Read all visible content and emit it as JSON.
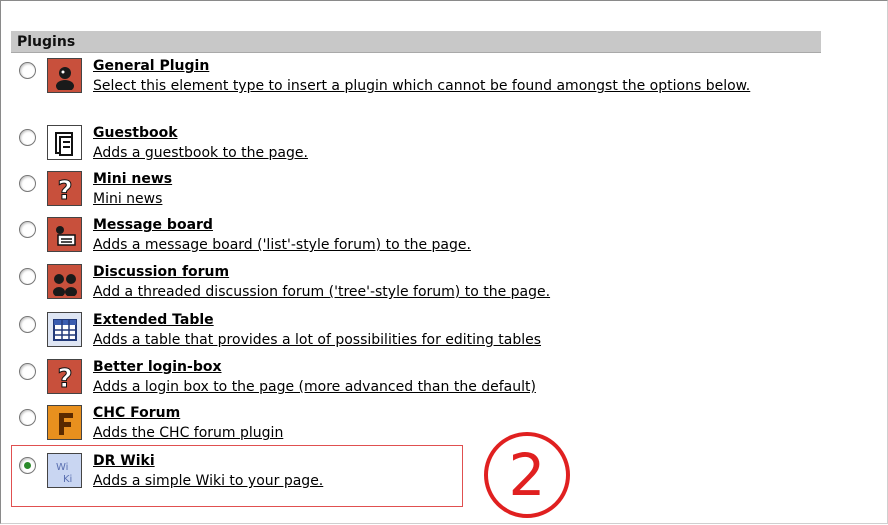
{
  "section": {
    "title": "Plugins"
  },
  "plugins": [
    {
      "title": "General Plugin",
      "description": "Select this element type to insert a plugin which cannot be found amongst the options below.",
      "icon": "general-plugin-icon",
      "selected": false
    },
    {
      "title": "Guestbook",
      "description": "Adds a guestbook to the page.",
      "icon": "guestbook-icon",
      "selected": false
    },
    {
      "title": "Mini news",
      "description": "Mini news",
      "icon": "mini-news-icon",
      "selected": false
    },
    {
      "title": "Message board",
      "description": "Adds a message board ('list'-style forum) to the page.",
      "icon": "message-board-icon",
      "selected": false
    },
    {
      "title": "Discussion forum",
      "description": "Add a threaded discussion forum ('tree'-style forum) to the page.",
      "icon": "discussion-forum-icon",
      "selected": false
    },
    {
      "title": "Extended Table",
      "description": "Adds a table that provides a lot of possibilities for editing tables",
      "icon": "extended-table-icon",
      "selected": false
    },
    {
      "title": "Better login-box",
      "description": "Adds a login box to the page (more advanced than the default)",
      "icon": "login-box-icon",
      "selected": false
    },
    {
      "title": "CHC Forum",
      "description": "Adds the CHC forum plugin",
      "icon": "chc-forum-icon",
      "selected": false
    },
    {
      "title": "DR Wiki",
      "description": "Adds a simple Wiki to your page.",
      "icon": "wiki-icon",
      "selected": true
    }
  ],
  "annotation": {
    "marker": "②"
  },
  "colors": {
    "header_bg": "#c8c8c8",
    "icon_red": "#c8503c",
    "callout_red": "#e02020",
    "radio_checked": "#2a8a2a"
  }
}
